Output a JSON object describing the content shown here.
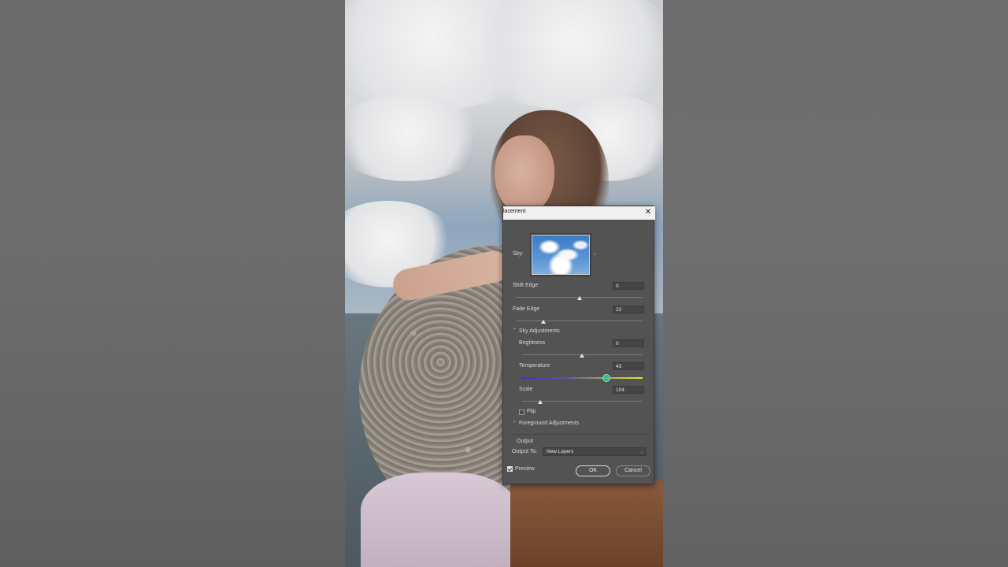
{
  "dialog": {
    "title": "lacement",
    "sky_label": "Sky:",
    "shift_edge": {
      "label": "Shift Edge",
      "value": "0"
    },
    "fade_edge": {
      "label": "Fade Edge",
      "value": "22"
    },
    "sky_adjustments_label": "Sky Adjustments",
    "brightness": {
      "label": "Brightness",
      "value": "0"
    },
    "temperature": {
      "label": "Temperature",
      "value": "43"
    },
    "scale": {
      "label": "Scale",
      "value": "104"
    },
    "flip_label": "Flip",
    "foreground_adjustments_label": "Foreground Adjustments",
    "output_section_label": "Output",
    "output_to_label": "Output To:",
    "output_to_value": "New Layers",
    "preview_label": "Preview",
    "ok_label": "OK",
    "cancel_label": "Cancel",
    "close_glyph": "✕",
    "chevron_down": "⌄",
    "chevron_right": "›",
    "caret": "⌄",
    "sky_more": "»"
  },
  "icons": [
    "close-icon",
    "chevron-down-icon",
    "chevron-right-icon",
    "checkbox-icon"
  ],
  "colors": {
    "dialog_bg": "#535353",
    "titlebar_bg": "#f0f0f0",
    "temp_cool": "#3a34c8",
    "temp_warm": "#e8e82a"
  }
}
